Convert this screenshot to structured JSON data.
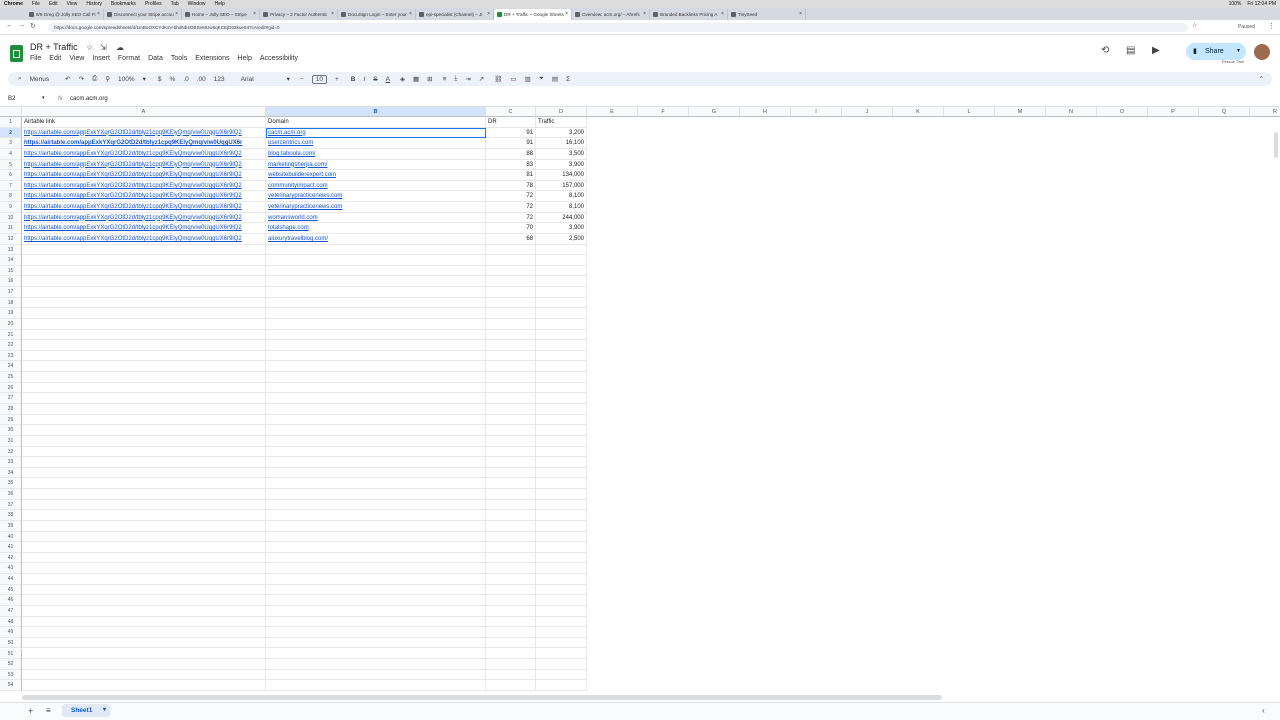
{
  "os_menu": [
    "Chrome",
    "File",
    "Edit",
    "View",
    "History",
    "Bookmarks",
    "Profiles",
    "Tab",
    "Window",
    "Help"
  ],
  "os_status": {
    "battery": "100%",
    "clock": "Fri 12:04 PM"
  },
  "tabs": [
    {
      "label": "8/8 Greg @ Jolly SEO Call Fi"
    },
    {
      "label": "Disconnect your Stripe accou"
    },
    {
      "label": "Home – Jolly SEO – Stripe"
    },
    {
      "label": "Privacy – 2 Factor Authentic"
    },
    {
      "label": "DocuSign Login – Enter your"
    },
    {
      "label": "epi-specialist (Channel) – Ji"
    },
    {
      "label": "DR + Traffic – Google Sheets",
      "active": true
    },
    {
      "label": "Overview: acm.org/ – Ahrefs"
    },
    {
      "label": "Branded Backlinks Pricing A"
    },
    {
      "label": "TinySeed"
    }
  ],
  "url": "https://docs.google.com/spreadsheets/d/1mBoOXCYdKsV-bhdNb4OBSeMUw6qKCEjDb3kue547cA/edit#gid=0",
  "doc": {
    "title": "DR + Traffic",
    "menus": [
      "File",
      "Edit",
      "View",
      "Insert",
      "Format",
      "Data",
      "Tools",
      "Extensions",
      "Help",
      "Accessibility"
    ],
    "share_label": "Share",
    "status_tip": "Rescue Time"
  },
  "toolbar": {
    "menus_label": "Menus",
    "zoom": "100%",
    "currency": "$",
    "percent": "%",
    "dec_decrease": ".0",
    "dec_increase": ".00",
    "number_format": "123",
    "font": "Arial",
    "font_size": "10"
  },
  "formula_bar": {
    "cell_ref": "B2",
    "fx": "fx",
    "value": "cacm.acm.org"
  },
  "columns": [
    "A",
    "B",
    "C",
    "D",
    "E",
    "F",
    "G",
    "H",
    "I",
    "J",
    "K",
    "L",
    "M",
    "N",
    "O",
    "P",
    "Q",
    "R"
  ],
  "headers": {
    "a": "Airtable link",
    "b": "Domain",
    "c": "DR",
    "d": "Traffic"
  },
  "rows": [
    {
      "a": "https://airtable.com/appExkYXqrG2OtD2d/tblyz1cpq9KElyQmq/viw0UqgUX6r9lQ2",
      "b": "cacm.acm.org",
      "c": "91",
      "d": "3,200"
    },
    {
      "a": "https://airtable.com/appExkYXqrG2OtD2d/tblyz1cpq9KElyQmq/viw0UqgUX6r",
      "b": "usercentrics.com",
      "c": "91",
      "d": "16,100",
      "bold": true
    },
    {
      "a": "https://airtable.com/appExkYXqrG2OtD2d/tblyz1cpq9KElyQmq/viw0UqgUX6r9lQ2",
      "b": "blog.taboola.com/",
      "c": "88",
      "d": "3,500"
    },
    {
      "a": "https://airtable.com/appExkYXqrG2OtD2d/tblyz1cpq9KElyQmq/viw0UqgUX6r9lQ2",
      "b": "marketingsherpa.com/",
      "c": "83",
      "d": "3,900"
    },
    {
      "a": "https://airtable.com/appExkYXqrG2OtD2d/tblyz1cpq9KElyQmq/viw0UqgUX6r9lQ2",
      "b": "websitebuilderexpert.com",
      "c": "81",
      "d": "134,000"
    },
    {
      "a": "https://airtable.com/appExkYXqrG2OtD2d/tblyz1cpq9KElyQmq/viw0UqgUX6r9lQ2",
      "b": "communityimpact.com",
      "c": "78",
      "d": "157,000"
    },
    {
      "a": "https://airtable.com/appExkYXqrG2OtD2d/tblyz1cpq9KElyQmq/viw0UqgUX6r9lQ2",
      "b": "veterinarypracticenews.com",
      "c": "72",
      "d": "8,100"
    },
    {
      "a": "https://airtable.com/appExkYXqrG2OtD2d/tblyz1cpq9KElyQmq/viw0UqgUX6r9lQ2",
      "b": "veterinarypracticenews.com",
      "c": "72",
      "d": "8,100"
    },
    {
      "a": "https://airtable.com/appExkYXqrG2OtD2d/tblyz1cpq9KElyQmq/viw0UqgUX6r9lQ2",
      "b": "womansworld.com",
      "c": "72",
      "d": "244,000"
    },
    {
      "a": "https://airtable.com/appExkYXqrG2OtD2d/tblyz1cpq9KElyQmq/viw0UqgUX6r9lQ2",
      "b": "totalshape.com",
      "c": "70",
      "d": "3,900"
    },
    {
      "a": "https://airtable.com/appExkYXqrG2OtD2d/tblyz1cpq9KElyQmq/viw0UqgUX6r9lQ2",
      "b": "aluxurytravelblog.com/",
      "c": "68",
      "d": "2,500"
    }
  ],
  "row_count": 54,
  "sheet": {
    "name": "Sheet1"
  }
}
